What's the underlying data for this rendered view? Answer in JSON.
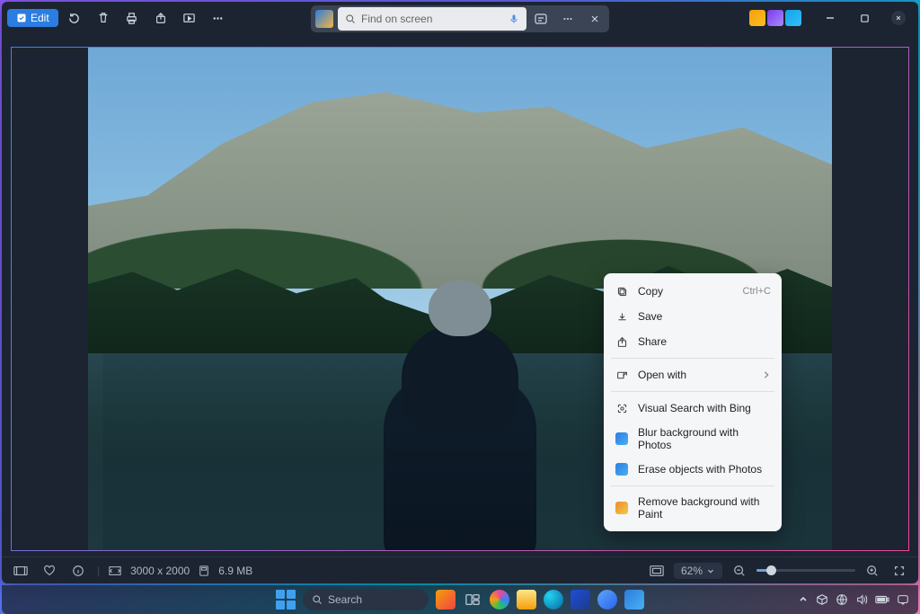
{
  "titlebar": {
    "edit_label": "Edit",
    "search_placeholder": "Find on screen"
  },
  "context_menu": {
    "copy": "Copy",
    "copy_shortcut": "Ctrl+C",
    "save": "Save",
    "share": "Share",
    "open_with": "Open with",
    "visual_search": "Visual Search with Bing",
    "blur_bg": "Blur background with Photos",
    "erase_obj": "Erase objects with Photos",
    "remove_bg": "Remove background with Paint"
  },
  "statusbar": {
    "dimensions": "3000 x 2000",
    "filesize": "6.9 MB",
    "zoom": "62%"
  },
  "taskbar": {
    "search_label": "Search"
  }
}
